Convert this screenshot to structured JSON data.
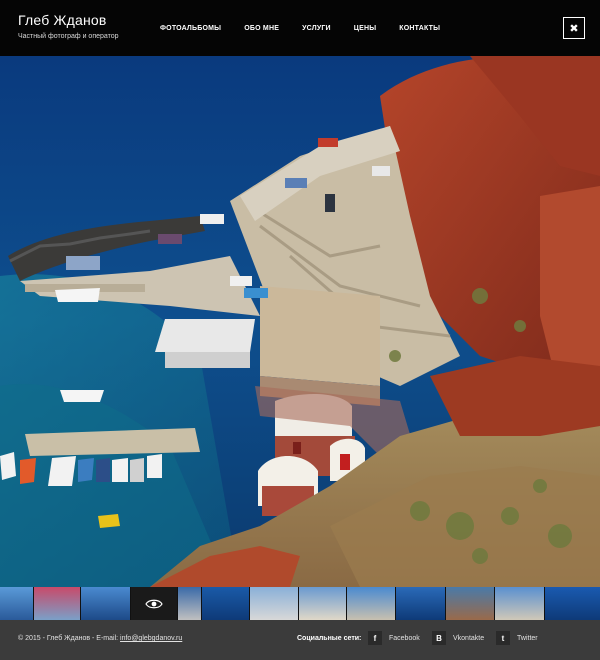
{
  "header": {
    "title": "Глеб Жданов",
    "subtitle": "Частный фотограф и оператор",
    "nav": [
      "ФОТОАЛЬБОМЫ",
      "ОБО МНЕ",
      "УСЛУГИ",
      "ЦЕНЫ",
      "КОНТАКТЫ"
    ],
    "close_icon": "close-icon",
    "close_label": "✖"
  },
  "hero": {
    "description_icon": "hero-photo"
  },
  "thumbnails": {
    "count": 12,
    "active_index": 3,
    "active_icon": "eye-icon"
  },
  "footer": {
    "copyright": "© 2015 - Глеб Жданов - E-mail:",
    "email": "info@glebgdanov.ru",
    "social_label": "Социальные сети:",
    "facebook_letter": "f",
    "facebook": "Facebook",
    "vk_letter": "B",
    "vkontakte": "Vkontakte",
    "twitter_letter": "t",
    "twitter": "Twitter"
  },
  "colors": {
    "header_bg": "#050505",
    "footer_bg": "#3b3b3b",
    "sea": "#0b3c78",
    "cliff": "#a8412a"
  }
}
